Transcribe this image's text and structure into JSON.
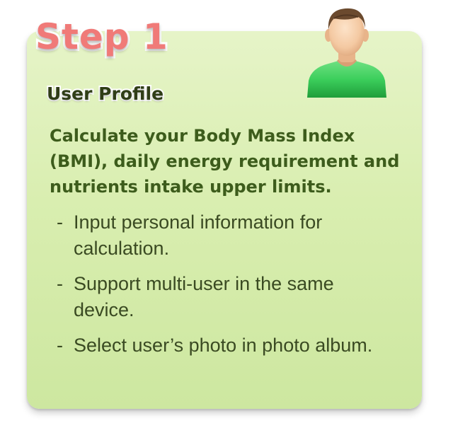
{
  "step_label": "Step 1",
  "section_title": "User Profile",
  "description": "Calculate your Body Mass Index (BMI), daily energy requirement and nutrients intake upper limits.",
  "bullet_marker": "-",
  "features": [
    {
      "text": "Input personal information for calculation."
    },
    {
      "text": "Support multi-user in the same device."
    },
    {
      "text": "Select user’s photo in photo album."
    }
  ],
  "icons": {
    "profile": "user-profile-avatar-icon"
  },
  "colors": {
    "card_background": "#d9eeb0",
    "step_label": "#f07a78",
    "title_text": "#2f3d16",
    "description_text": "#3d5c1c",
    "feature_text": "#3a4a22",
    "avatar_shirt": "#3ccf5c"
  }
}
